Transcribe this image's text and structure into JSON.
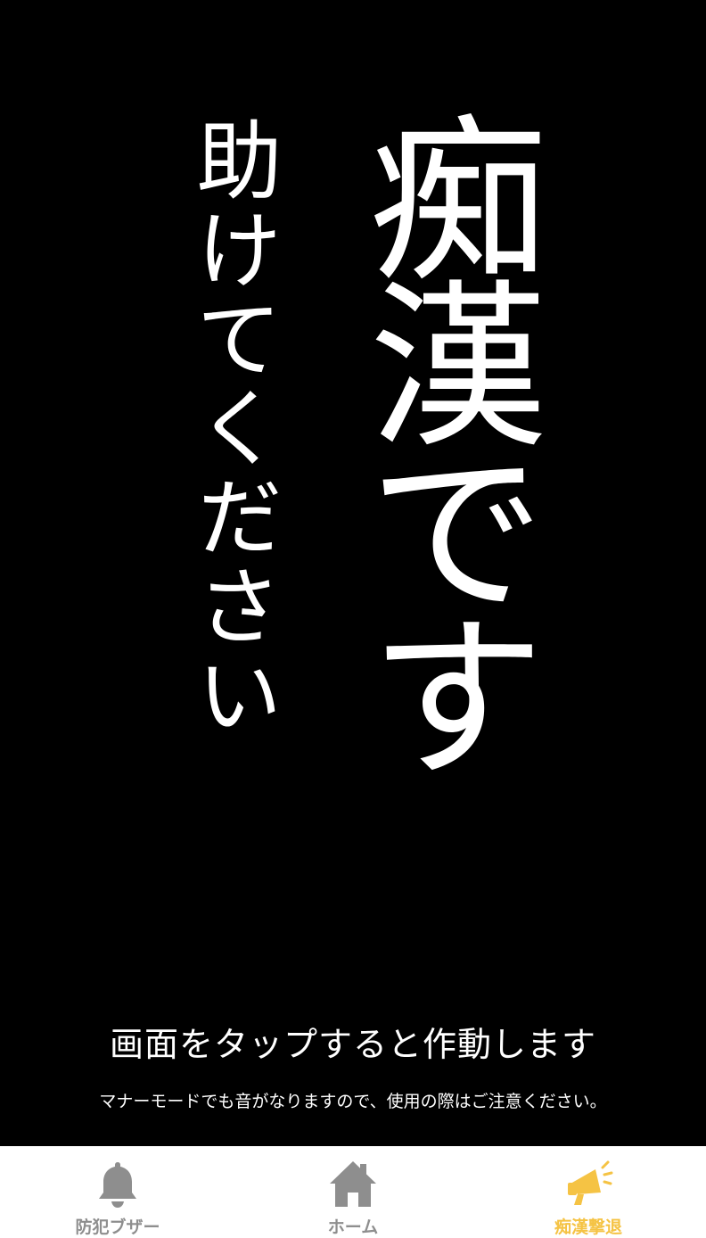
{
  "main": {
    "headline": "痴漢です",
    "subline": "助けてください",
    "tap_message": "画面をタップすると作動します",
    "note": "マナーモードでも音がなりますので、使用の際はご注意ください。"
  },
  "tabbar": {
    "tabs": [
      {
        "label": "防犯ブザー",
        "icon": "bell-icon",
        "active": false
      },
      {
        "label": "ホーム",
        "icon": "home-icon",
        "active": false
      },
      {
        "label": "痴漢撃退",
        "icon": "megaphone-icon",
        "active": true
      }
    ],
    "colors": {
      "inactive": "#8e8e8e",
      "active": "#f5c344"
    }
  },
  "colors": {
    "background": "#000000",
    "text": "#ffffff"
  }
}
